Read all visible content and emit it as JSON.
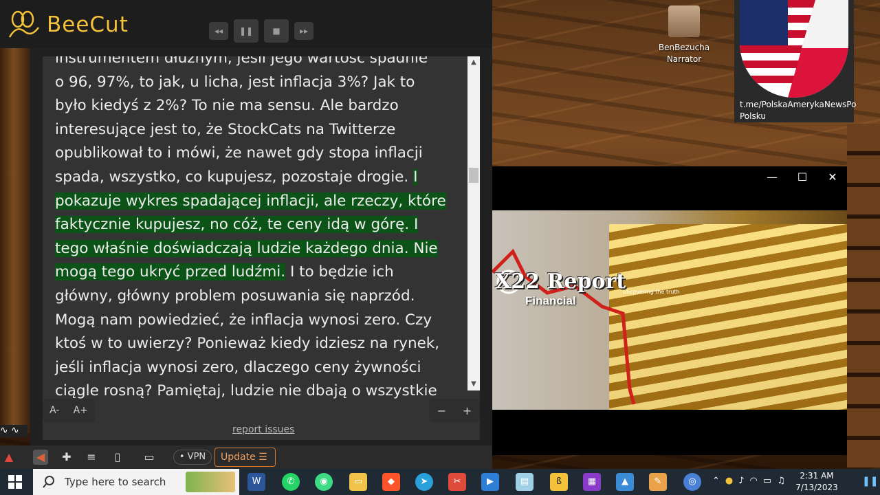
{
  "app": {
    "name": "BeeCut"
  },
  "reader": {
    "lines": [
      {
        "text": "instrumentem dłużnym, jeśli jego wartość spadnie",
        "hl": false
      },
      {
        "text": "o 96, 97%, to jak, u licha, jest inflacja 3%? Jak to",
        "hl": false
      },
      {
        "text": "było kiedyś z 2%? To nie ma sensu. Ale bardzo",
        "hl": false
      },
      {
        "text": "interesujące jest to, że StockCats na Twitterze",
        "hl": false
      },
      {
        "text": "opublikował to i mówi, że nawet gdy stopa inflacji",
        "hl": false
      },
      {
        "text": "spada, wszystko, co kupujesz, pozostaje drogie. ",
        "hl_tail": "I"
      },
      {
        "text": "pokazuje wykres spadającej inflacji, ale rzeczy, które",
        "hl": true
      },
      {
        "text": "faktycznie kupujesz, no cóż, te ceny idą w górę. I",
        "hl": true
      },
      {
        "text": "tego właśnie doświadczają ludzie każdego dnia. Nie",
        "hl": true
      },
      {
        "text": "mogą tego ukryć przed ludźmi.",
        "hl": true,
        "tail": " I to będzie ich"
      },
      {
        "text": "główny, główny problem posuwania się naprzód.",
        "hl": false
      },
      {
        "text": "Mogą nam powiedzieć, że inflacja wynosi zero. Czy",
        "hl": false
      },
      {
        "text": "ktoś w to uwierzy? Ponieważ kiedy idziesz na rynek,",
        "hl": false
      },
      {
        "text": "jeśli inflacja wynosi zero, dlaczego ceny żywności",
        "hl": false
      },
      {
        "text": "ciągle rosną? Pamiętaj, ludzie nie dbają o wszystkie",
        "hl": false
      }
    ],
    "font_decrease": "A-",
    "font_increase": "A+",
    "zoom_out": "−",
    "zoom_in": "+",
    "report_link": "report issues"
  },
  "browser": {
    "vpn": "VPN",
    "update": "Update"
  },
  "desktop": {
    "narrator_label_1": "BenBezucha",
    "narrator_label_2": "Narrator",
    "flag_label_1": "t.me/PolskaAmerykaNewsPo",
    "flag_label_2": "Polsku"
  },
  "video": {
    "title": "X22 Report",
    "subtitle": "Financial",
    "tagline": "uncovering the truth"
  },
  "taskbar": {
    "search_placeholder": "Type here to search",
    "time": "2:31 AM",
    "date": "7/13/2023"
  },
  "colors": {
    "accent": "#f3c13a",
    "highlight": "#0b5316",
    "update": "#d77a32"
  }
}
